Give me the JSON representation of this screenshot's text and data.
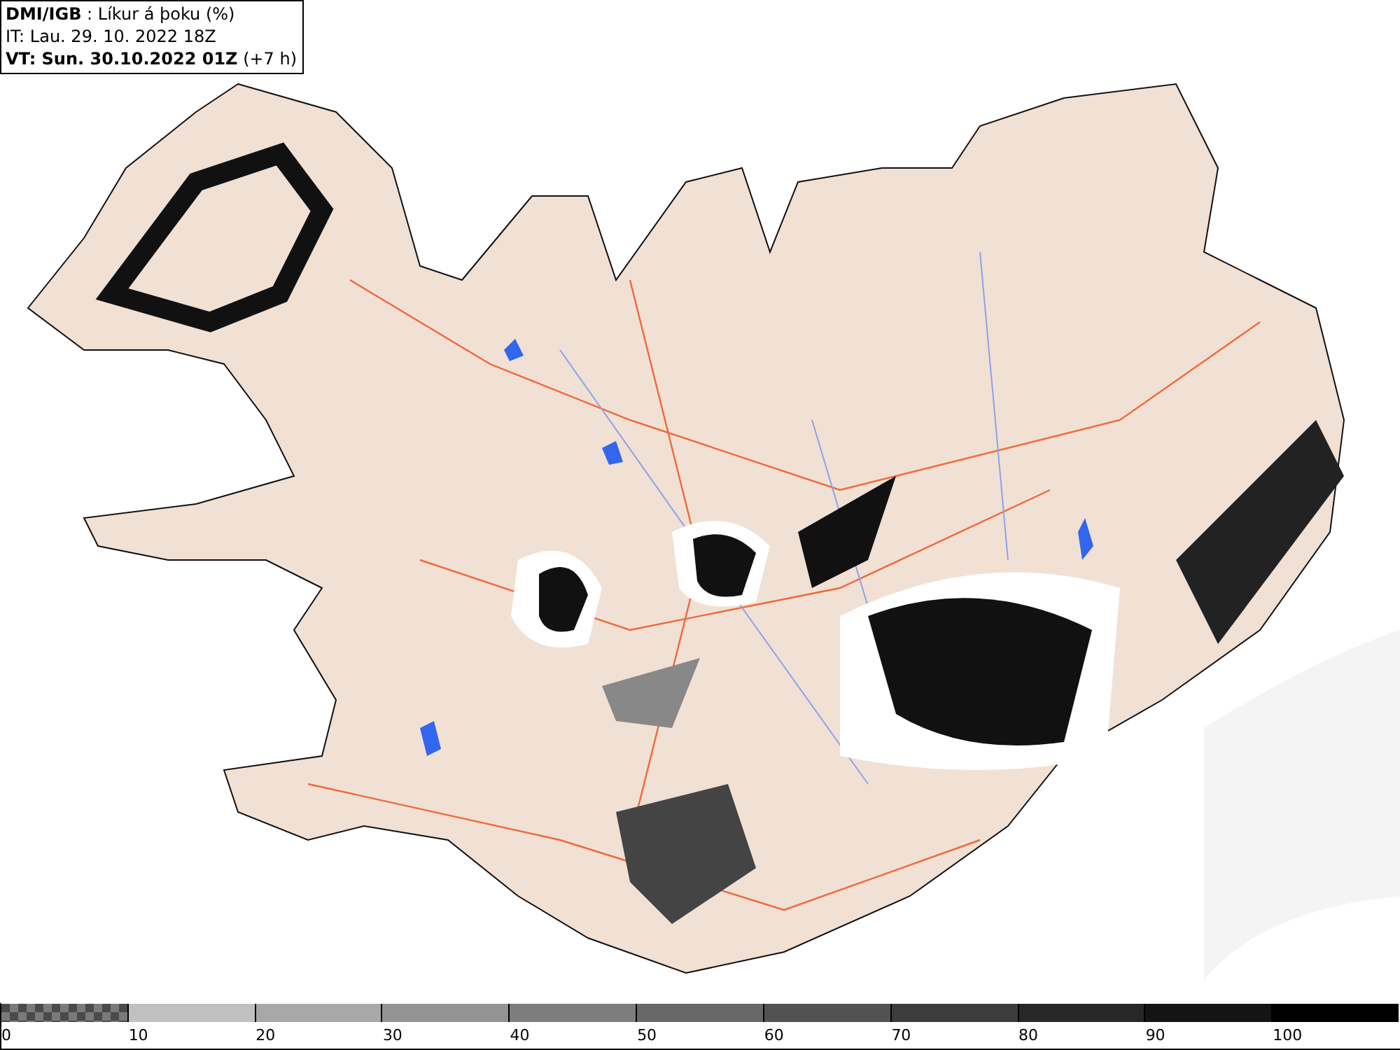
{
  "header": {
    "lines": [
      "**DMI/IGB** : Líkur á þoku (%)",
      "IT: Lau. 29. 10. 2022 18Z",
      "**VT: Sun. 30.10.2022 01Z** (+7 h)"
    ]
  },
  "legend": {
    "items": [
      {
        "label": "0",
        "kind": "checker",
        "color": "#7a7a7a"
      },
      {
        "label": "10",
        "kind": "solid",
        "color": "#c0c0c0"
      },
      {
        "label": "20",
        "kind": "solid",
        "color": "#a8a8a8"
      },
      {
        "label": "30",
        "kind": "solid",
        "color": "#939393"
      },
      {
        "label": "40",
        "kind": "solid",
        "color": "#7d7d7d"
      },
      {
        "label": "50",
        "kind": "solid",
        "color": "#686868"
      },
      {
        "label": "60",
        "kind": "solid",
        "color": "#525252"
      },
      {
        "label": "70",
        "kind": "solid",
        "color": "#3c3c3c"
      },
      {
        "label": "80",
        "kind": "solid",
        "color": "#272727"
      },
      {
        "label": "90",
        "kind": "solid",
        "color": "#141414"
      },
      {
        "label": "100",
        "kind": "solid",
        "color": "#000000"
      }
    ]
  }
}
